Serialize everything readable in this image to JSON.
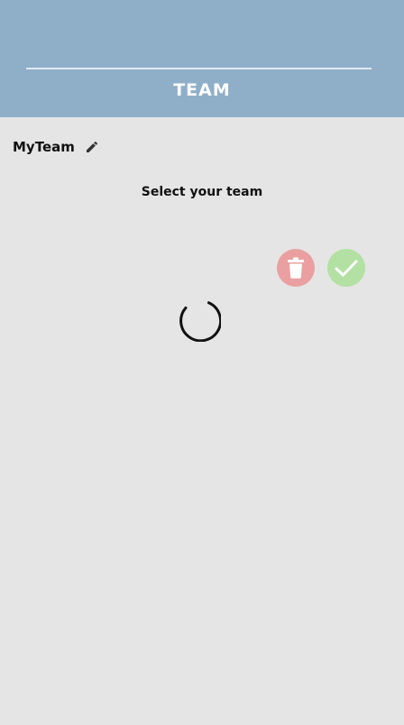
{
  "header": {
    "title": "TEAM",
    "background": "#8fafc9"
  },
  "team": {
    "name": "MyTeam",
    "edit_icon": "pencil-icon"
  },
  "subtitle": "Select your team",
  "actions": {
    "delete": {
      "icon": "trash-icon",
      "color": "#eaa0a0"
    },
    "confirm": {
      "icon": "check-icon",
      "color": "#b3e0a3"
    }
  },
  "loading": {
    "icon": "loading-spinner"
  }
}
